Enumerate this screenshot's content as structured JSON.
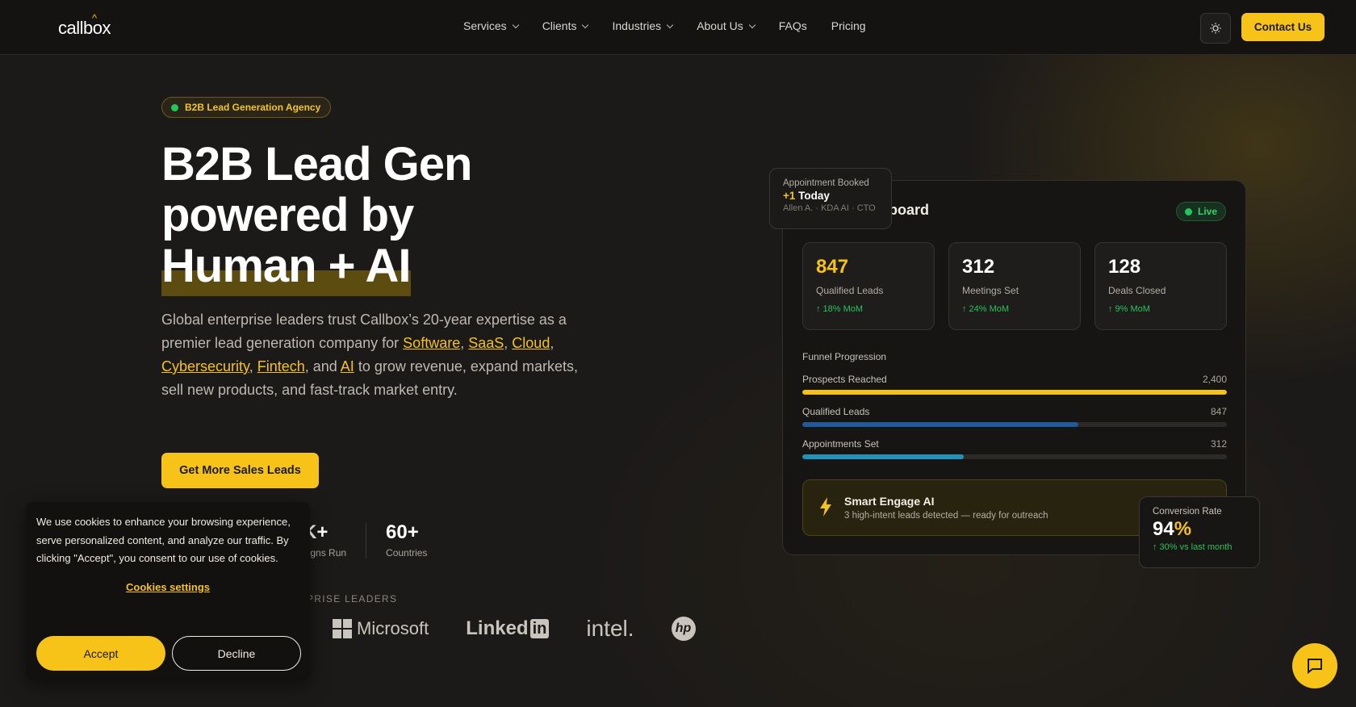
{
  "nav": {
    "logo": "callbox",
    "items": [
      {
        "label": "Services",
        "has_dropdown": true
      },
      {
        "label": "Clients",
        "has_dropdown": true
      },
      {
        "label": "Industries",
        "has_dropdown": true
      },
      {
        "label": "About Us",
        "has_dropdown": true
      },
      {
        "label": "FAQs",
        "has_dropdown": false
      },
      {
        "label": "Pricing",
        "has_dropdown": false
      }
    ],
    "theme_icon": "sun-icon",
    "contact_label": "Contact Us"
  },
  "hero": {
    "badge": "B2B Lead Generation Agency",
    "title_line1": "B2B Lead Gen",
    "title_line2": "powered by",
    "title_line3": "Human + AI",
    "desc_part1": "Global enterprise leaders trust Callbox’s 20-year expertise as a premier lead generation company for ",
    "link_software": "Software",
    "sep1": ", ",
    "link_saas": "SaaS",
    "sep2": ", ",
    "link_cloud": "Cloud",
    "sep3": ", ",
    "link_cyber": "Cybersecurity",
    "sep4": ", ",
    "link_fintech": "Fintech",
    "sep5": ", and ",
    "link_ai": "AI",
    "desc_part2": " to grow revenue, expand markets, sell new products, and fast-track market entry.",
    "cta_label": "Get More Sales Leads"
  },
  "stats": [
    {
      "value": "K+",
      "label": "aigns Run"
    },
    {
      "value": "60+",
      "label": "Countries"
    }
  ],
  "trusted_label": "PRISE LEADERS",
  "logos": {
    "microsoft": "Microsoft",
    "linkedin_text": "Linked",
    "linkedin_box": "in",
    "intel": "intel.",
    "hp": "hp"
  },
  "dashboard": {
    "title": "nboard",
    "live_label": "Live",
    "cards": [
      {
        "value": "847",
        "label": "Qualified Leads",
        "change": "↑ 18% MoM"
      },
      {
        "value": "312",
        "label": "Meetings Set",
        "change": "↑ 24% MoM"
      },
      {
        "value": "128",
        "label": "Deals Closed",
        "change": "↑ 9% MoM"
      }
    ],
    "funnel_title": "Funnel Progression",
    "funnel": [
      {
        "label": "Prospects Reached",
        "value": "2,400",
        "fill_pct": 100,
        "color": "#f5c21a"
      },
      {
        "label": "Qualified Leads",
        "value": "847",
        "fill_pct": 65,
        "color": "#1e5a9c"
      },
      {
        "label": "Appointments Set",
        "value": "312",
        "fill_pct": 38,
        "color": "#1f94b8"
      }
    ],
    "smart_title": "Smart Engage AI",
    "smart_sub": "3 high-intent leads detected — ready for outreach"
  },
  "appointment": {
    "label": "Appointment Booked",
    "plus": "+1",
    "value": " Today",
    "sub": "Allen A. · KDA AI · CTO"
  },
  "conversion": {
    "label": "Conversion Rate",
    "value": "94",
    "pct": "%",
    "change": "↑ 30% vs last month"
  },
  "cookie": {
    "text": "We use cookies to enhance your browsing experience, serve personalized content, and analyze our traffic. By clicking \"Accept\", you consent to our use of cookies.",
    "settings_label": "Cookies settings",
    "accept_label": "Accept",
    "decline_label": "Decline"
  },
  "chat_icon": "chat-bubble-icon",
  "colors": {
    "accent": "#f7c318",
    "positive": "#27c35c",
    "live": "#22c55e"
  }
}
